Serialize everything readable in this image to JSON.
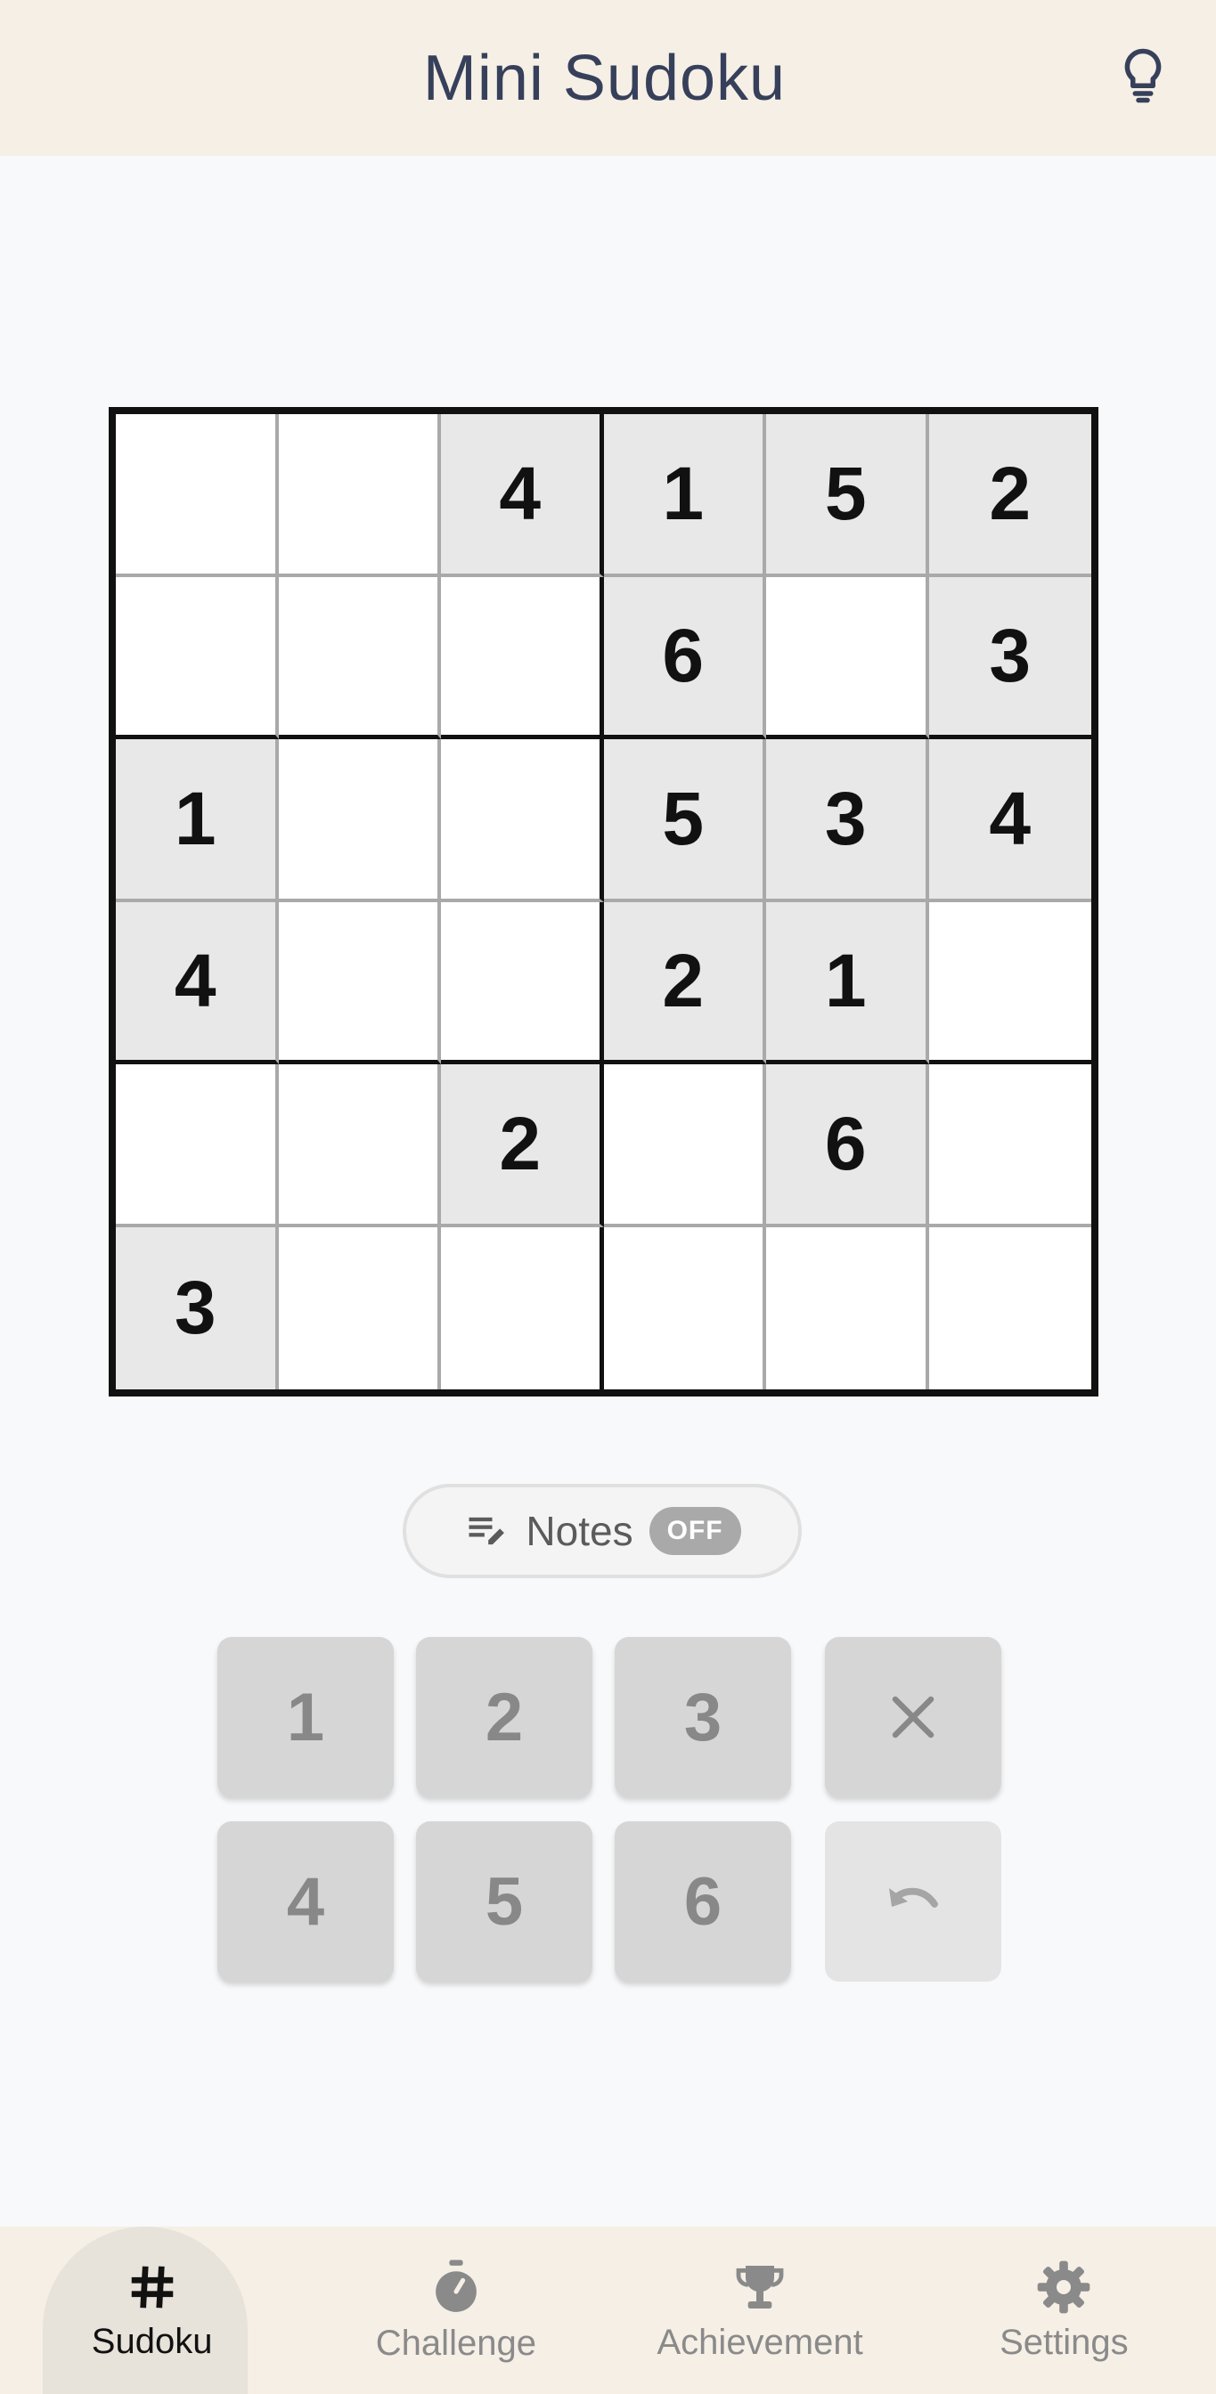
{
  "header": {
    "title": "Mini Sudoku",
    "hint_icon": "lightbulb-icon"
  },
  "board": {
    "size": 6,
    "cells": [
      [
        "",
        "",
        "4",
        "1",
        "5",
        "2"
      ],
      [
        "",
        "",
        "",
        "6",
        "",
        "3"
      ],
      [
        "1",
        "",
        "",
        "5",
        "3",
        "4"
      ],
      [
        "4",
        "",
        "",
        "2",
        "1",
        ""
      ],
      [
        "",
        "",
        "2",
        "",
        "6",
        ""
      ],
      [
        "3",
        "",
        "",
        "",
        "",
        ""
      ]
    ]
  },
  "notes": {
    "label": "Notes",
    "state": "OFF",
    "icon": "edit-note-icon"
  },
  "keypad": {
    "numbers": [
      "1",
      "2",
      "3",
      "4",
      "5",
      "6"
    ],
    "erase_icon": "close-icon",
    "undo_icon": "undo-icon",
    "undo_enabled": false
  },
  "nav": {
    "items": [
      {
        "label": "Sudoku",
        "icon": "hash-icon",
        "active": true
      },
      {
        "label": "Challenge",
        "icon": "stopwatch-icon",
        "active": false
      },
      {
        "label": "Achievement",
        "icon": "trophy-icon",
        "active": false
      },
      {
        "label": "Settings",
        "icon": "gear-icon",
        "active": false
      }
    ]
  },
  "colors": {
    "header_bg": "#f5efe6",
    "page_bg": "#f8f9fa",
    "given_cell": "#e8e8e8",
    "key_bg": "#d6d6d6",
    "title_text": "#37405a"
  }
}
